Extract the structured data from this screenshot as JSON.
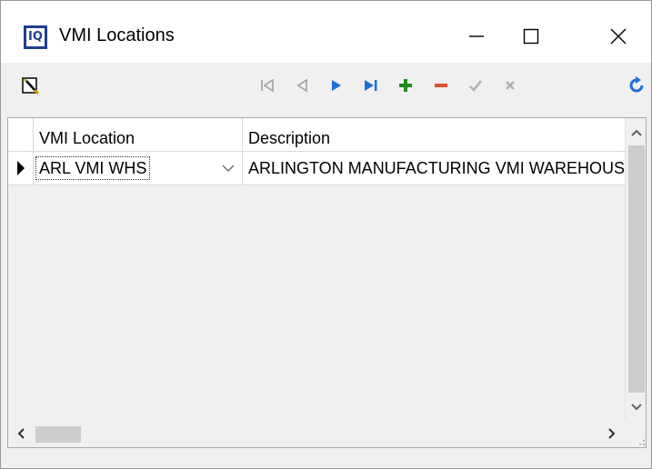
{
  "window": {
    "title": "VMI Locations",
    "app_icon_text": "IQ",
    "minimize_icon": "minimize-icon",
    "maximize_icon": "maximize-icon",
    "close_icon": "close-icon"
  },
  "toolbar": {
    "buttons": [
      {
        "name": "edit-mode",
        "icon": "pencil-note-icon"
      },
      {
        "name": "first",
        "icon": "first-record-icon"
      },
      {
        "name": "prior",
        "icon": "prior-record-icon"
      },
      {
        "name": "next",
        "icon": "next-record-icon"
      },
      {
        "name": "last",
        "icon": "last-record-icon"
      },
      {
        "name": "insert",
        "icon": "plus-icon"
      },
      {
        "name": "delete",
        "icon": "minus-icon"
      },
      {
        "name": "post",
        "icon": "checkmark-icon"
      },
      {
        "name": "cancel",
        "icon": "x-icon"
      },
      {
        "name": "refresh",
        "icon": "refresh-icon"
      }
    ],
    "colors": {
      "nav_disabled": "#a0a0a0",
      "nav_active": "#1e6fd9",
      "insert": "#1e8c1e",
      "delete": "#e0502a",
      "refresh": "#1e6fd9"
    }
  },
  "grid": {
    "columns": [
      {
        "key": "vmi_location",
        "label": "VMI Location"
      },
      {
        "key": "description",
        "label": "Description"
      }
    ],
    "rows": [
      {
        "vmi_location": "ARL VMI WHS",
        "description": "ARLINGTON MANUFACTURING VMI WAREHOUSE"
      }
    ]
  }
}
